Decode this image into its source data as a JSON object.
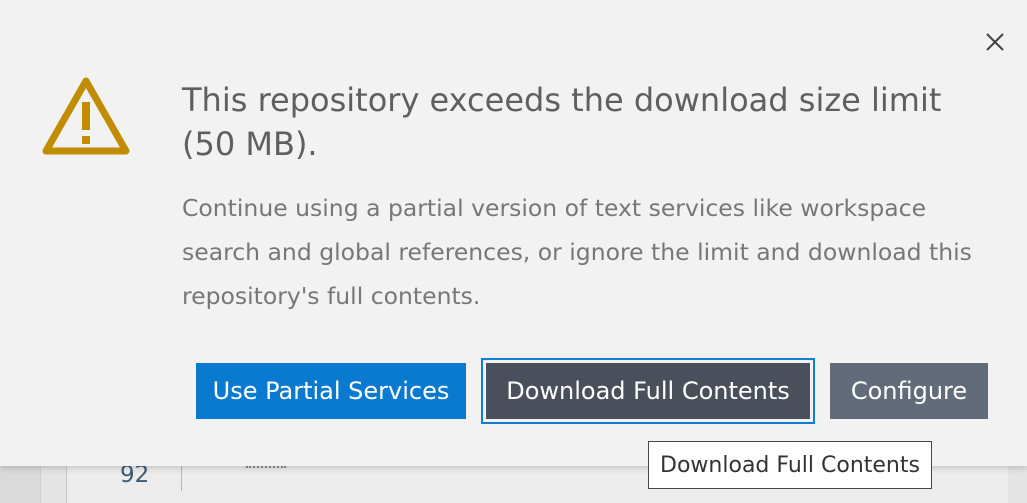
{
  "dialog": {
    "title": "This repository exceeds the download size limit (50 MB).",
    "description": "Continue using a partial version of text services like workspace search and global references, or ignore the limit and download this repository's full contents.",
    "buttons": {
      "partial_label": "Use Partial Services",
      "download_label": "Download Full Contents",
      "configure_label": "Configure"
    },
    "icons": {
      "warning": "warning-icon",
      "close": "close-icon"
    },
    "colors": {
      "warning": "#c28c00",
      "primary": "#0a7ad0",
      "download": "#4a4f5c",
      "configure": "#626b79",
      "focus_outline": "#0f7fd6"
    }
  },
  "tooltip": {
    "text": "Download Full Contents"
  },
  "editor": {
    "line_number": "92"
  }
}
